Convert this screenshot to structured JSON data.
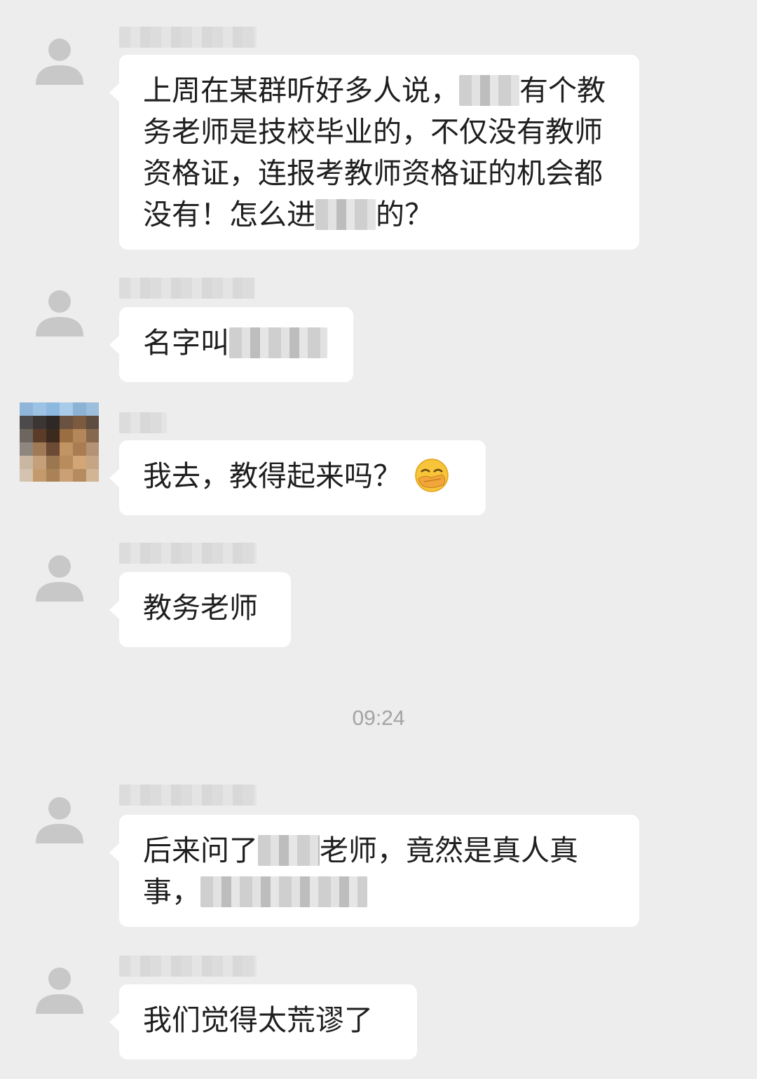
{
  "time_divider": "09:24",
  "messages": [
    {
      "parts": [
        "上周在某群听好多人说，",
        "有个教务老师是技校毕业的，不仅没有教师资格证，连报考教师资格证的机会都没有！怎么进",
        "的？"
      ]
    },
    {
      "parts": [
        "名字叫"
      ]
    },
    {
      "parts": [
        "我去，教得起来吗？"
      ],
      "emoji": "face-palm-emoji"
    },
    {
      "parts": [
        "教务老师"
      ]
    },
    {
      "parts": [
        "后来问了",
        "老师，竟然是真人真事，"
      ]
    },
    {
      "parts": [
        "我们觉得太荒谬了"
      ]
    }
  ],
  "colors": {
    "background": "#ededed",
    "bubble": "#ffffff",
    "text": "#1f1f1f",
    "time": "#a3a3a3"
  },
  "icons": {
    "default_avatar": "person-silhouette-icon"
  }
}
